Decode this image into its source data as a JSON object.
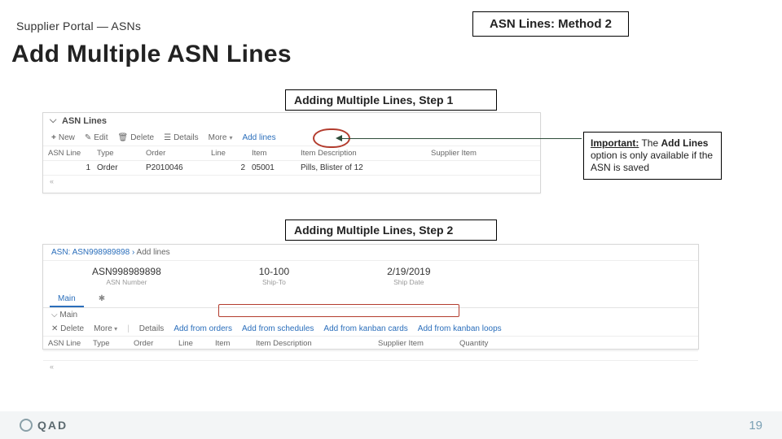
{
  "header": {
    "breadcrumb": "Supplier Portal — ASNs",
    "badge": "ASN Lines: Method 2",
    "title": "Add Multiple ASN Lines"
  },
  "steps": {
    "step1": "Adding Multiple Lines, Step 1",
    "step2": "Adding Multiple Lines, Step 2"
  },
  "callout": {
    "important_label": "Important:",
    "text_before": " The ",
    "bold_phrase": "Add Lines",
    "text_after": " option is only available if the ASN is saved"
  },
  "shot1": {
    "panel_title": "ASN Lines",
    "toolbar": {
      "new": "New",
      "edit": "Edit",
      "delete": "Delete",
      "details": "Details",
      "more": "More",
      "add_lines": "Add lines"
    },
    "columns": [
      "ASN Line",
      "Type",
      "Order",
      "Line",
      "Item",
      "Item Description",
      "Supplier Item"
    ],
    "row": [
      "1",
      "Order",
      "P2010046",
      "2",
      "05001",
      "Pills, Blister of 12",
      ""
    ]
  },
  "shot2": {
    "breadcrumb_prefix": "ASN: ASN998989898",
    "breadcrumb_current": "Add lines",
    "info": {
      "asn_number": {
        "value": "ASN998989898",
        "label": "ASN Number"
      },
      "ship_to": {
        "value": "10-100",
        "label": "Ship-To"
      },
      "ship_date": {
        "value": "2/19/2019",
        "label": "Ship Date"
      }
    },
    "tabs": {
      "main": "Main"
    },
    "section": "Main",
    "toolbar": {
      "delete": "Delete",
      "more": "More",
      "details": "Details",
      "add_from_orders": "Add from orders",
      "add_from_schedules": "Add from schedules",
      "add_from_kanban_cards": "Add from kanban cards",
      "add_from_kanban_loops": "Add from kanban loops"
    },
    "columns": [
      "ASN Line",
      "Type",
      "Order",
      "Line",
      "Item",
      "Item Description",
      "Supplier Item",
      "Quantity"
    ]
  },
  "footer": {
    "logo_text": "QAD",
    "page_number": "19"
  }
}
